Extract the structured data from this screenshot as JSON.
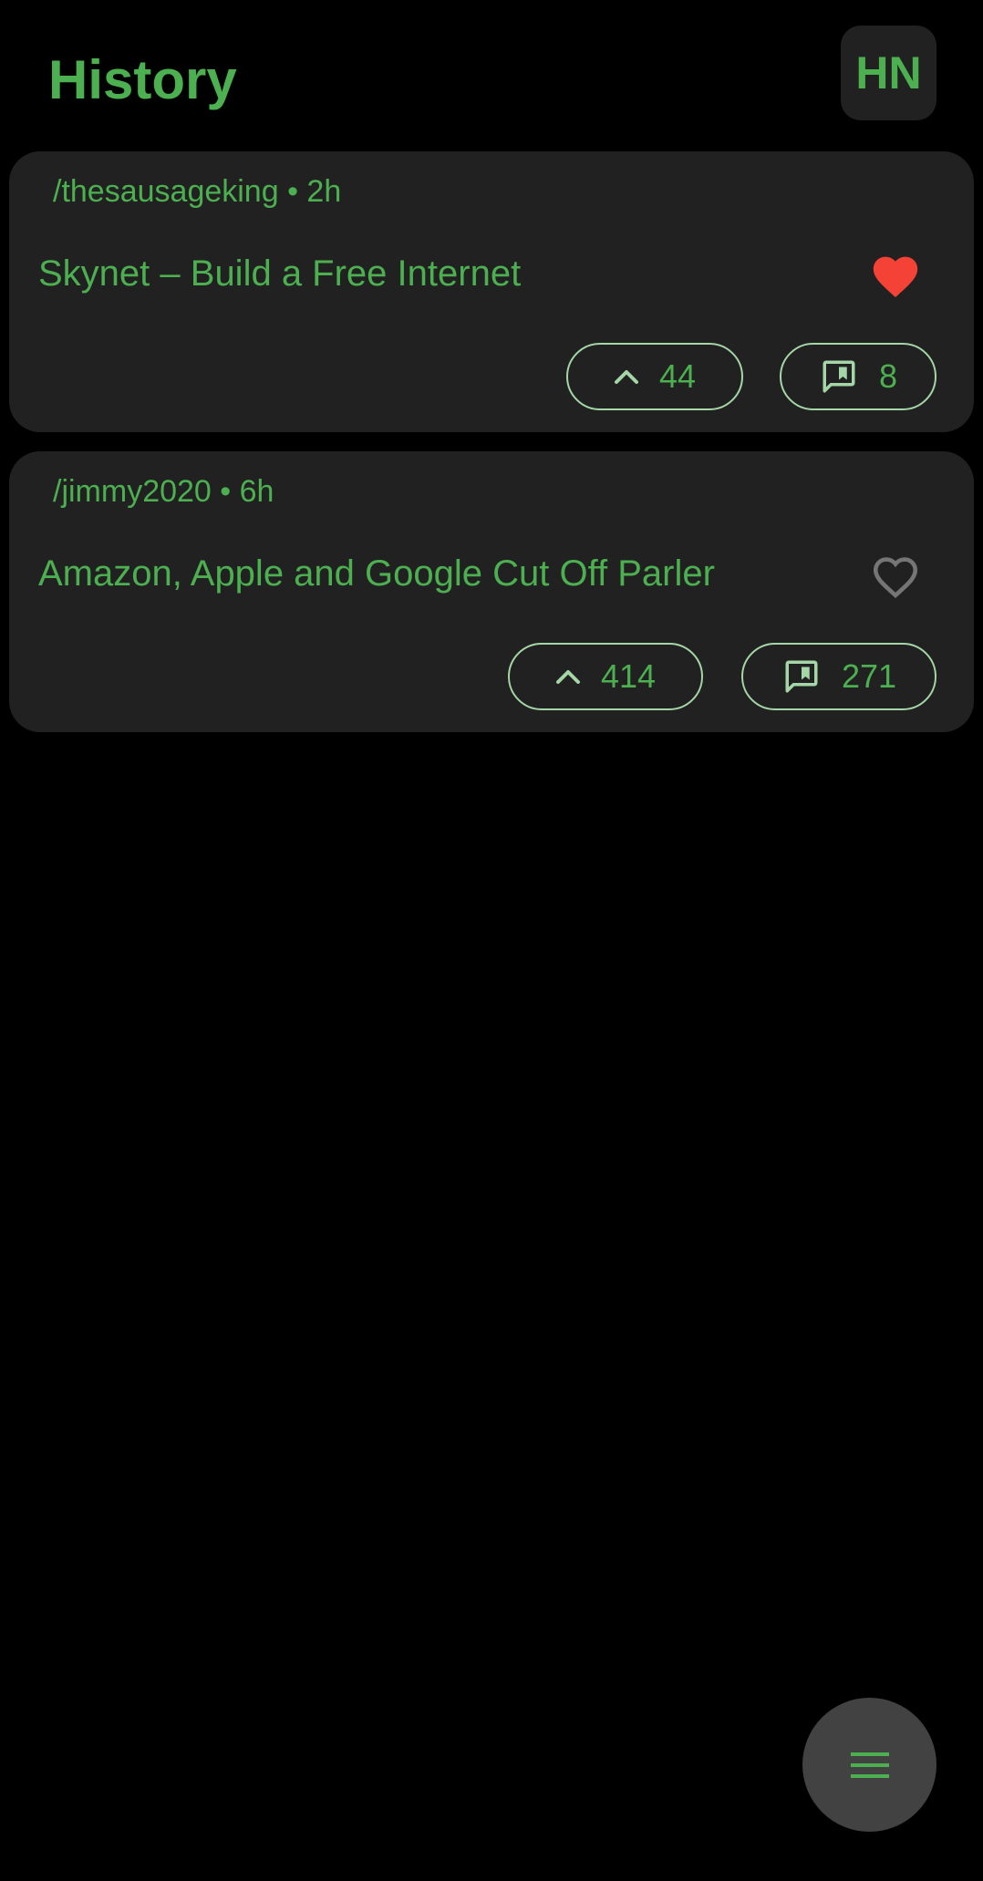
{
  "header": {
    "title": "History",
    "logo_label": "HN"
  },
  "colors": {
    "background": "#000000",
    "card": "#212121",
    "accent_green": "#4caf50",
    "pill_border": "#a5d6a7",
    "favorite_red": "#f44336",
    "unfavorite_gray": "#757575",
    "fab": "#424242"
  },
  "stories": [
    {
      "meta": "/thesausageking • 2h",
      "title": "Skynet – Build a Free Internet",
      "favorited": true,
      "score": "44",
      "comments": "8"
    },
    {
      "meta": "/jimmy2020 • 6h",
      "title": "Amazon, Apple and Google Cut Off Parler",
      "favorited": false,
      "score": "414",
      "comments": "271"
    }
  ],
  "icons": {
    "favorite": "heart-icon",
    "upvote": "chevron-up-icon",
    "comments": "comment-bookmark-icon",
    "menu": "menu-icon"
  }
}
